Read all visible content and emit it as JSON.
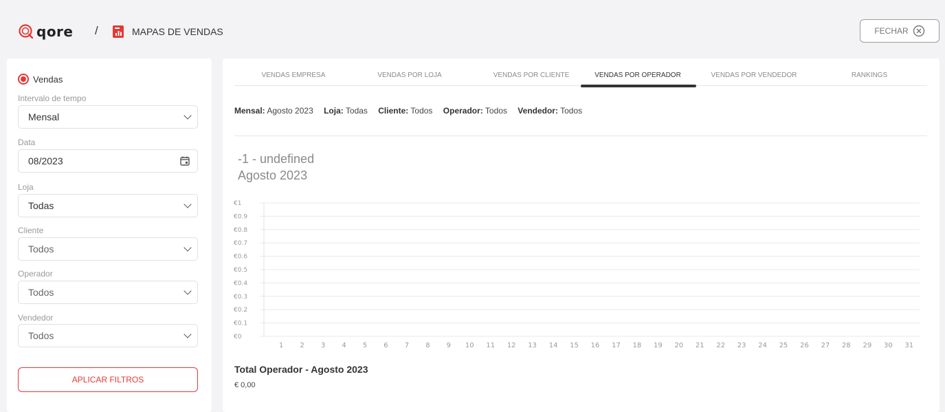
{
  "header": {
    "logo_text": "qore",
    "breadcrumb_separator": "/",
    "page_title": "MAPAS DE VENDAS",
    "close_label": "FECHAR"
  },
  "sidebar": {
    "radio_label": "Vendas",
    "fields": [
      {
        "label": "Intervalo de tempo",
        "value": "Mensal"
      },
      {
        "label": "Data",
        "value": "08/2023"
      },
      {
        "label": "Loja",
        "value": "Todas"
      },
      {
        "label": "Cliente",
        "value": "Todos"
      },
      {
        "label": "Operador",
        "value": "Todos"
      },
      {
        "label": "Vendedor",
        "value": "Todos"
      }
    ],
    "apply_label": "APLICAR FILTROS"
  },
  "tabs": [
    {
      "label": "VENDAS EMPRESA",
      "active": false
    },
    {
      "label": "VENDAS POR LOJA",
      "active": false
    },
    {
      "label": "VENDAS POR CLIENTE",
      "active": false
    },
    {
      "label": "VENDAS POR OPERADOR",
      "active": true
    },
    {
      "label": "VENDAS POR VENDEDOR",
      "active": false
    },
    {
      "label": "RANKINGS",
      "active": false
    }
  ],
  "filters_summary": {
    "mensal_key": "Mensal:",
    "mensal_value": "Agosto 2023",
    "loja_key": "Loja:",
    "loja_value": "Todas",
    "cliente_key": "Cliente:",
    "cliente_value": "Todos",
    "operador_key": "Operador:",
    "operador_value": "Todos",
    "vendedor_key": "Vendedor:",
    "vendedor_value": "Todos"
  },
  "chart_data": {
    "type": "bar",
    "title": "-1 - undefined",
    "subtitle": "Agosto 2023",
    "xlabel": "",
    "ylabel": "",
    "categories": [
      "1",
      "2",
      "3",
      "4",
      "5",
      "6",
      "7",
      "8",
      "9",
      "10",
      "11",
      "12",
      "13",
      "14",
      "15",
      "16",
      "17",
      "18",
      "19",
      "20",
      "21",
      "22",
      "23",
      "24",
      "25",
      "26",
      "27",
      "28",
      "29",
      "30",
      "31"
    ],
    "values": [
      0,
      0,
      0,
      0,
      0,
      0,
      0,
      0,
      0,
      0,
      0,
      0,
      0,
      0,
      0,
      0,
      0,
      0,
      0,
      0,
      0,
      0,
      0,
      0,
      0,
      0,
      0,
      0,
      0,
      0,
      0
    ],
    "ylim": [
      0,
      1
    ],
    "yticks": [
      "€0",
      "€0.1",
      "€0.2",
      "€0.3",
      "€0.4",
      "€0.5",
      "€0.6",
      "€0.7",
      "€0.8",
      "€0.9",
      "€1"
    ],
    "grid": true
  },
  "total": {
    "label": "Total Operador - Agosto 2023",
    "value": "€ 0,00"
  },
  "colors": {
    "accent": "#e53935",
    "active_tab_underline": "#333333"
  }
}
